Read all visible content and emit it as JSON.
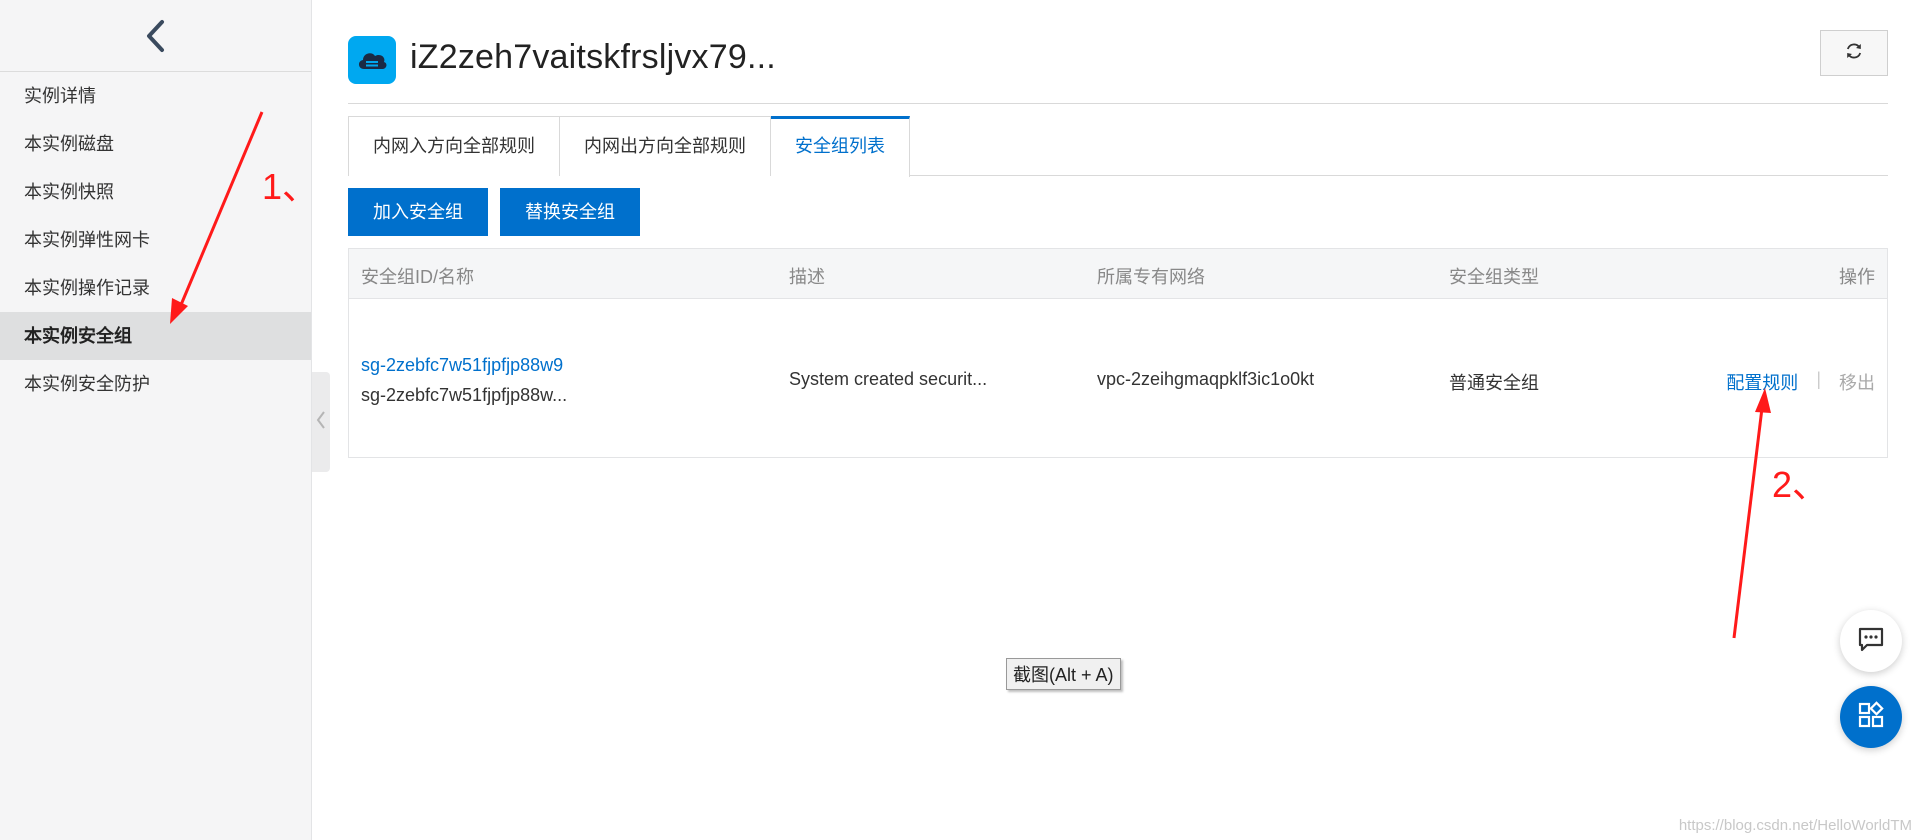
{
  "sidebar": {
    "back_icon": "chevron-left-icon",
    "items": [
      {
        "label": "实例详情"
      },
      {
        "label": "本实例磁盘"
      },
      {
        "label": "本实例快照"
      },
      {
        "label": "本实例弹性网卡"
      },
      {
        "label": "本实例操作记录"
      },
      {
        "label": "本实例安全组",
        "active": true
      },
      {
        "label": "本实例安全防护"
      }
    ]
  },
  "header": {
    "title": "iZ2zeh7vaitskfrsljvx79...",
    "icon": "cloud-server-icon",
    "refresh_icon": "refresh-icon"
  },
  "tabs": [
    {
      "label": "内网入方向全部规则"
    },
    {
      "label": "内网出方向全部规则"
    },
    {
      "label": "安全组列表",
      "active": true
    }
  ],
  "actions": {
    "join_label": "加入安全组",
    "replace_label": "替换安全组"
  },
  "table": {
    "headers": {
      "id_name": "安全组ID/名称",
      "description": "描述",
      "vpc": "所属专有网络",
      "type": "安全组类型",
      "operation": "操作"
    },
    "rows": [
      {
        "id": "sg-2zebfc7w51fjpfjp88w9",
        "name": "sg-2zebfc7w51fjpfjp88w...",
        "description": "System created securit...",
        "vpc": "vpc-2zeihgmaqpklf3ic1o0kt",
        "type": "普通安全组",
        "configure_label": "配置规则",
        "separator": "|",
        "remove_label": "移出"
      }
    ]
  },
  "tooltip": "截图(Alt + A)",
  "annotations": {
    "label1": "1、",
    "label2": "2、",
    "color": "#ff1a1a"
  },
  "floating": {
    "chat_icon": "chat-icon",
    "apps_icon": "apps-icon"
  },
  "watermark": "https://blog.csdn.net/HelloWorldTM",
  "colors": {
    "primary": "#0070cc",
    "accent": "#ff6a00",
    "instance_icon_bg": "#00a8f0"
  }
}
